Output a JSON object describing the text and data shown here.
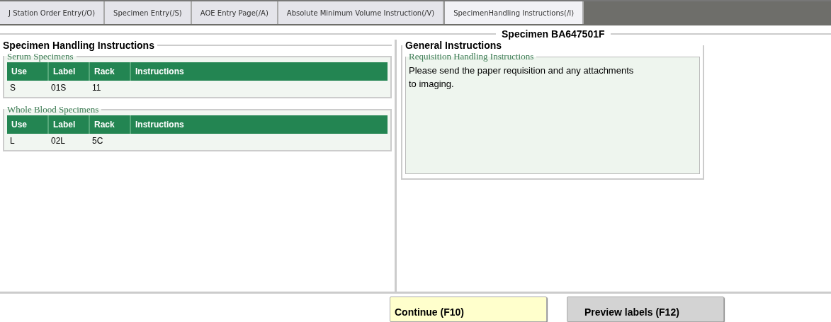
{
  "tabs": [
    {
      "label": "J Station Order Entry(/O)",
      "selected": false
    },
    {
      "label": "Specimen Entry(/S)",
      "selected": false
    },
    {
      "label": "AOE Entry Page(/A)",
      "selected": false
    },
    {
      "label": "Absolute Minimum Volume Instruction(/V)",
      "selected": false
    },
    {
      "label": "SpecimenHandling Instructions(/I)",
      "selected": true
    }
  ],
  "specimen_title": "Specimen  BA647501F",
  "handling": {
    "title": "Specimen Handling Instructions",
    "groups": [
      {
        "title": "Serum Specimens",
        "columns": [
          "Use",
          "Label",
          "Rack",
          "Instructions"
        ],
        "rows": [
          [
            "S",
            "01S",
            "11",
            ""
          ]
        ]
      },
      {
        "title": "Whole Blood Specimens",
        "columns": [
          "Use",
          "Label",
          "Rack",
          "Instructions"
        ],
        "rows": [
          [
            "L",
            "02L",
            "5C",
            ""
          ]
        ]
      }
    ]
  },
  "general": {
    "title": "General Instructions",
    "group_title": "Requisition Handling Instructions",
    "text": "Please send the paper requisition and any attachments to imaging."
  },
  "buttons": [
    {
      "label": "Continue (F10)",
      "kind": "primary"
    },
    {
      "label": "Preview labels (F12)",
      "kind": "secondary"
    }
  ]
}
